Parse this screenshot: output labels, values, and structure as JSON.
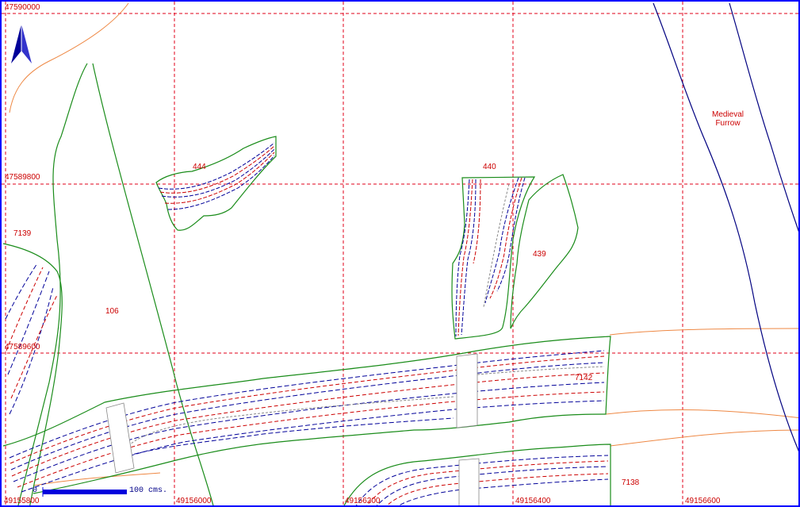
{
  "map": {
    "grid_color": "#e0001a",
    "grid_x_labels": [
      "49155800",
      "49156000",
      "49156200",
      "49156400",
      "49156600"
    ],
    "grid_y_labels": [
      "47590000",
      "47589800",
      "47589600"
    ],
    "feature_labels": {
      "f444": "444",
      "f440": "440",
      "f439": "439",
      "f7139": "7139",
      "f106": "106",
      "f7142": "7142",
      "f7138": "7138",
      "medieval": "Medieval",
      "furrow": "Furrow"
    },
    "scale": {
      "zero": "0",
      "text": "100  cms."
    },
    "north_arrow_icon": "north-arrow-icon",
    "colors": {
      "outline": "#1a8c1a",
      "contour_blue": "#000099",
      "contour_red": "#cc0000",
      "contour_grey": "#888888",
      "orange_line": "#ee8844",
      "navy_line": "#000080",
      "border": "#0000ff"
    }
  }
}
